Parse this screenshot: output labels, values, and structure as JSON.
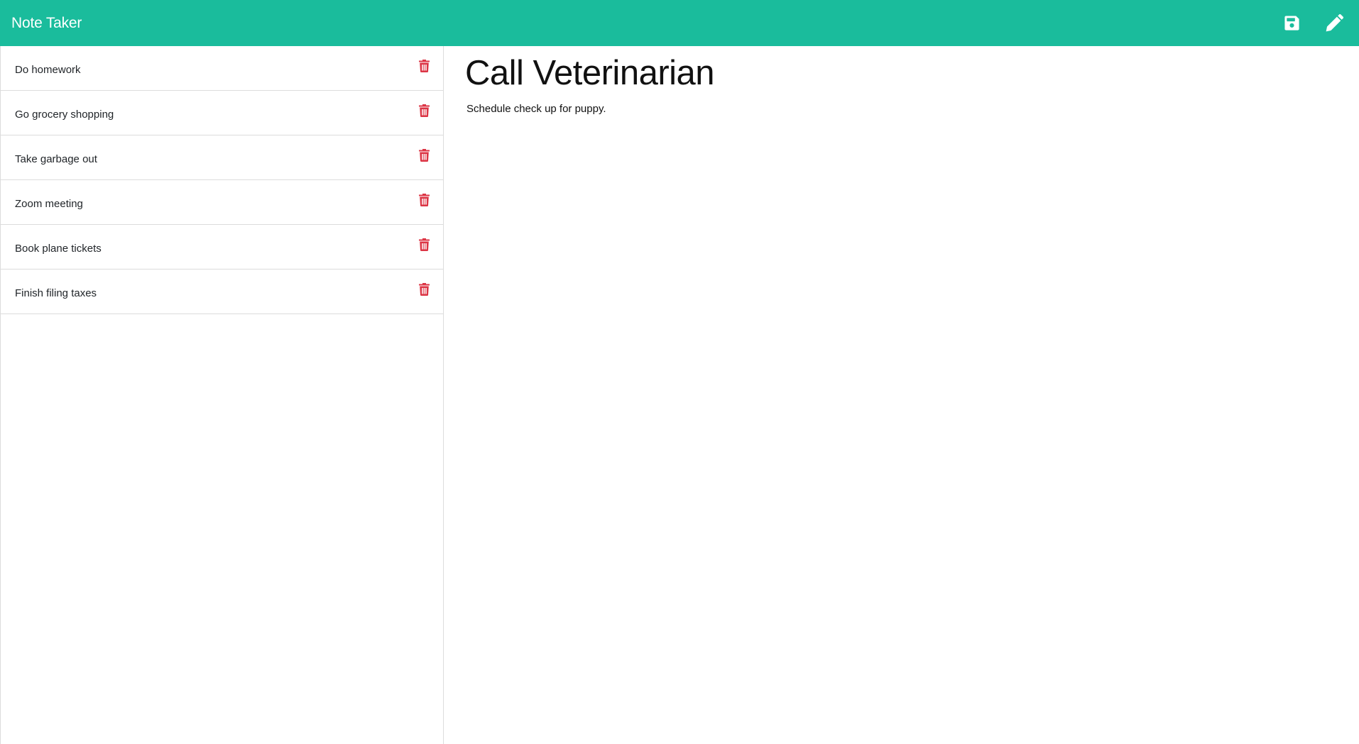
{
  "colors": {
    "navbar_bg": "#1abc9c",
    "nav_icon": "#ffffff",
    "delete_icon": "#dc3545"
  },
  "navbar": {
    "brand": "Note Taker",
    "save_icon": "floppy-disk-icon",
    "new_note_icon": "pencil-icon"
  },
  "notes": [
    {
      "title": "Do homework"
    },
    {
      "title": "Go grocery shopping"
    },
    {
      "title": "Take garbage out"
    },
    {
      "title": "Zoom meeting"
    },
    {
      "title": "Book plane tickets"
    },
    {
      "title": "Finish filing taxes"
    }
  ],
  "editor": {
    "title_value": "Call Veterinarian",
    "text_value": "Schedule check up for puppy."
  }
}
